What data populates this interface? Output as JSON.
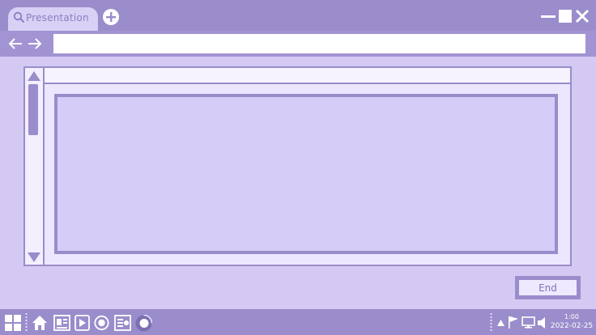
{
  "browser": {
    "tab_title": "Presentation",
    "address_value": ""
  },
  "viewer": {
    "end_button_label": "End"
  },
  "taskbar": {
    "apps": [
      "windows-start-icon",
      "home-icon",
      "news-icon",
      "play-icon",
      "record-icon",
      "slides-icon",
      "media-icon"
    ],
    "tray": [
      "caret-up-icon",
      "flag-icon",
      "monitor-icon",
      "volume-icon"
    ],
    "clock_time": "1:00",
    "clock_date": "2022-02-25"
  },
  "colors": {
    "background": "#d3c9f3",
    "chrome": "#9b8ccb",
    "chrome_light": "#a293d3",
    "slide": "#d5ccf7",
    "white": "#ffffff"
  }
}
